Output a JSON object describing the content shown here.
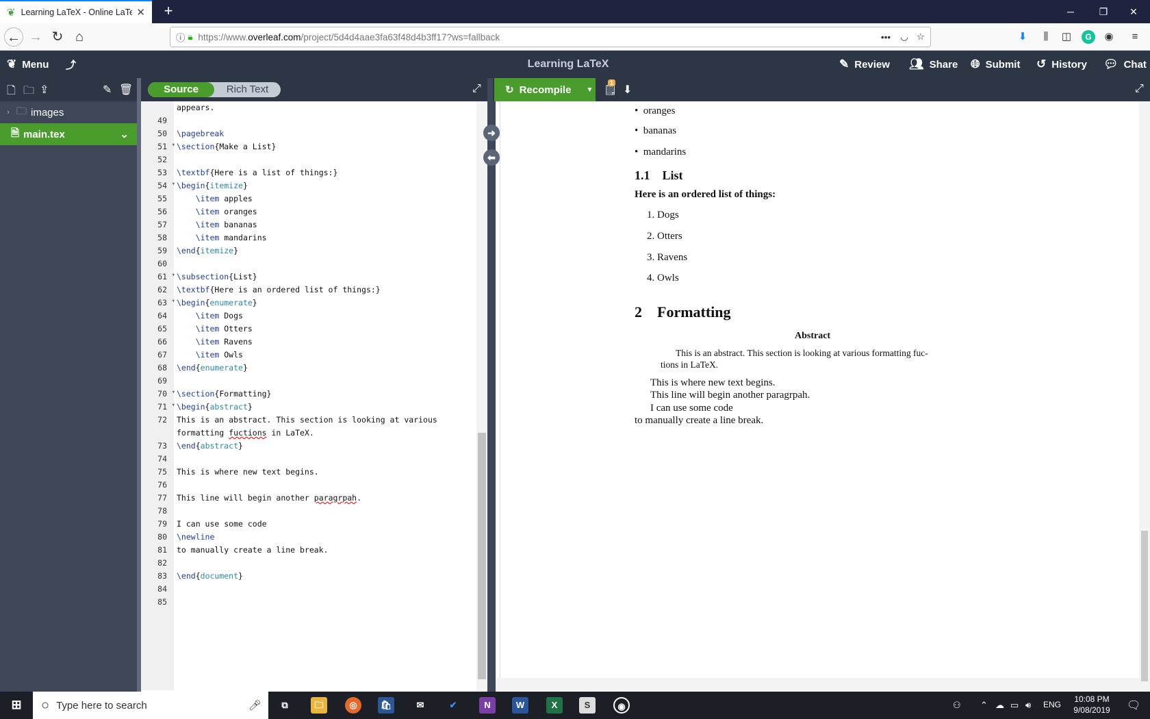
{
  "browser": {
    "tab_title": "Learning LaTeX - Online LaTeX",
    "url_prefix": "https://www.",
    "url_domain": "overleaf.com",
    "url_path": "/project/5d4d4aae3fa63f48d4b3ff17?ws=fallback"
  },
  "toolbar": {
    "menu": "Menu",
    "project_title": "Learning LaTeX",
    "review": "Review",
    "share": "Share",
    "submit": "Submit",
    "history": "History",
    "chat": "Chat"
  },
  "filetree": {
    "folder": "images",
    "file": "main.tex"
  },
  "editor": {
    "source_label": "Source",
    "rich_label": "Rich Text",
    "lines": [
      {
        "n": "",
        "html": "appears."
      },
      {
        "n": "49",
        "html": ""
      },
      {
        "n": "50",
        "html": "<span class=\"k\">\\pagebreak</span>"
      },
      {
        "n": "51",
        "fold": true,
        "html": "<span class=\"k\">\\section</span>{Make a List}"
      },
      {
        "n": "52",
        "html": ""
      },
      {
        "n": "53",
        "html": "<span class=\"k\">\\textbf</span>{Here is a list of things:}"
      },
      {
        "n": "54",
        "fold": true,
        "html": "<span class=\"k\">\\begin</span>{<span class=\"a\">itemize</span>}"
      },
      {
        "n": "55",
        "html": "    <span class=\"k\">\\item</span> apples"
      },
      {
        "n": "56",
        "html": "    <span class=\"k\">\\item</span> oranges"
      },
      {
        "n": "57",
        "html": "    <span class=\"k\">\\item</span> bananas"
      },
      {
        "n": "58",
        "html": "    <span class=\"k\">\\item</span> mandarins"
      },
      {
        "n": "59",
        "html": "<span class=\"k\">\\end</span>{<span class=\"a\">itemize</span>}"
      },
      {
        "n": "60",
        "html": ""
      },
      {
        "n": "61",
        "fold": true,
        "html": "<span class=\"k\">\\subsection</span>{List}"
      },
      {
        "n": "62",
        "html": "<span class=\"k\">\\textbf</span>{Here is an ordered list of things:}"
      },
      {
        "n": "63",
        "fold": true,
        "html": "<span class=\"k\">\\begin</span>{<span class=\"a\">enumerate</span>}"
      },
      {
        "n": "64",
        "html": "    <span class=\"k\">\\item</span> Dogs"
      },
      {
        "n": "65",
        "html": "    <span class=\"k\">\\item</span> Otters"
      },
      {
        "n": "66",
        "html": "    <span class=\"k\">\\item</span> Ravens"
      },
      {
        "n": "67",
        "html": "    <span class=\"k\">\\item</span> Owls"
      },
      {
        "n": "68",
        "html": "<span class=\"k\">\\end</span>{<span class=\"a\">enumerate</span>}"
      },
      {
        "n": "69",
        "html": ""
      },
      {
        "n": "70",
        "fold": true,
        "html": "<span class=\"k\">\\section</span>{Formatting}"
      },
      {
        "n": "71",
        "fold": true,
        "html": "<span class=\"k\">\\begin</span>{<span class=\"a\">abstract</span>}"
      },
      {
        "n": "72",
        "html": "This is an abstract. This section is looking at various"
      },
      {
        "n": "",
        "html": "formatting <span class=\"sp\">fuctions</span> in LaTeX."
      },
      {
        "n": "73",
        "html": "<span class=\"k\">\\end</span>{<span class=\"a\">abstract</span>}"
      },
      {
        "n": "74",
        "html": ""
      },
      {
        "n": "75",
        "html": "This is where new text begins."
      },
      {
        "n": "76",
        "html": ""
      },
      {
        "n": "77",
        "html": "This line will begin another <span class=\"sp\">paragrpah</span>."
      },
      {
        "n": "78",
        "html": ""
      },
      {
        "n": "79",
        "html": "I can use some code"
      },
      {
        "n": "80",
        "html": "<span class=\"k\">\\newline</span>"
      },
      {
        "n": "81",
        "html": "to manually create a line break."
      },
      {
        "n": "82",
        "html": ""
      },
      {
        "n": "83",
        "html": "<span class=\"k\">\\end</span>{<span class=\"a\">document</span>}"
      },
      {
        "n": "84",
        "html": ""
      },
      {
        "n": "85",
        "html": ""
      }
    ]
  },
  "pdf": {
    "recompile": "Recompile",
    "badge": "1",
    "bullets": [
      "oranges",
      "bananas",
      "mandarins"
    ],
    "subsection_num": "1.1",
    "subsection_title": "List",
    "ordered_heading": "Here is an ordered list of things:",
    "ordered_items": [
      "1.  Dogs",
      "2.  Otters",
      "3.  Ravens",
      "4.  Owls"
    ],
    "section_num": "2",
    "section_title": "Formatting",
    "abstract_title": "Abstract",
    "abstract_line1": "This is an abstract.  This section is looking at various formatting fuc-",
    "abstract_line2": "tions in LaTeX.",
    "body1": "This is where new text begins.",
    "body2": "This line will begin another paragrpah.",
    "body3": "I can use some code",
    "body4": "to manually create a line break."
  },
  "taskbar": {
    "search_placeholder": "Type here to search",
    "lang": "ENG",
    "time": "10:08 PM",
    "date": "9/08/2019"
  }
}
